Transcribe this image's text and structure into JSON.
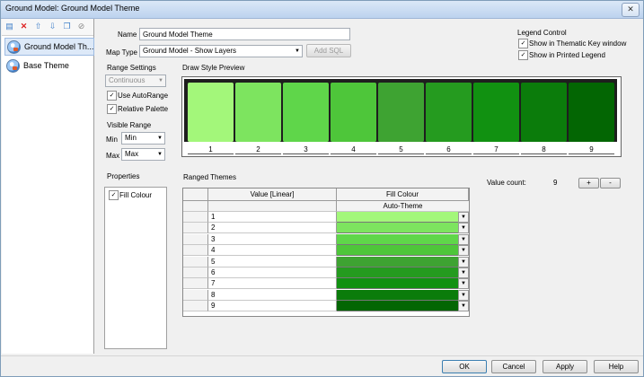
{
  "window": {
    "title": "Ground Model: Ground Model Theme",
    "close_glyph": "✕"
  },
  "toolbar_icons": [
    "new-icon",
    "delete-icon",
    "move-up-icon",
    "move-down-icon",
    "copy-icon",
    "disable-icon"
  ],
  "tree": {
    "items": [
      {
        "label": "Ground Model Th...",
        "selected": true
      },
      {
        "label": "Base Theme",
        "selected": false
      }
    ]
  },
  "form": {
    "name_label": "Name",
    "name_value": "Ground Model Theme",
    "map_type_label": "Map Type",
    "map_type_value": "Ground Model - Show Layers",
    "add_sql_label": "Add SQL"
  },
  "legend_control": {
    "title": "Legend Control",
    "show_thematic": "Show in Thematic Key window",
    "show_printed": "Show in Printed Legend"
  },
  "range_settings": {
    "title": "Range Settings",
    "mode_value": "Continuous",
    "use_autorange": "Use AutoRange",
    "relative_palette": "Relative Palette"
  },
  "visible_range": {
    "title": "Visible Range",
    "min_label": "Min",
    "min_value": "Min",
    "max_label": "Max",
    "max_value": "Max"
  },
  "preview": {
    "title": "Draw Style Preview",
    "swatches": [
      {
        "label": "1",
        "color": "#a3f77a"
      },
      {
        "label": "2",
        "color": "#7de45f"
      },
      {
        "label": "3",
        "color": "#5fd64a"
      },
      {
        "label": "4",
        "color": "#4ec63a"
      },
      {
        "label": "5",
        "color": "#3ea332"
      },
      {
        "label": "6",
        "color": "#259b1f"
      },
      {
        "label": "7",
        "color": "#119111"
      },
      {
        "label": "8",
        "color": "#0b7c0b"
      },
      {
        "label": "9",
        "color": "#036603"
      }
    ]
  },
  "properties": {
    "title": "Properties",
    "fill_colour": "Fill Colour"
  },
  "ranged_themes": {
    "title": "Ranged Themes",
    "value_count_label": "Value count:",
    "value_count": "9",
    "add_glyph": "+",
    "remove_glyph": "-",
    "col_value": "Value [Linear]",
    "col_fill": "Fill Colour",
    "auto_theme": "Auto-Theme",
    "rows": [
      {
        "value": "1",
        "color": "#a3f77a"
      },
      {
        "value": "2",
        "color": "#7de45f"
      },
      {
        "value": "3",
        "color": "#5fd64a"
      },
      {
        "value": "4",
        "color": "#4ec63a"
      },
      {
        "value": "5",
        "color": "#3ea332"
      },
      {
        "value": "6",
        "color": "#259b1f"
      },
      {
        "value": "7",
        "color": "#119111"
      },
      {
        "value": "8",
        "color": "#0b7c0b"
      },
      {
        "value": "9",
        "color": "#036603"
      }
    ]
  },
  "buttons": {
    "ok": "OK",
    "cancel": "Cancel",
    "apply": "Apply",
    "help": "Help"
  }
}
